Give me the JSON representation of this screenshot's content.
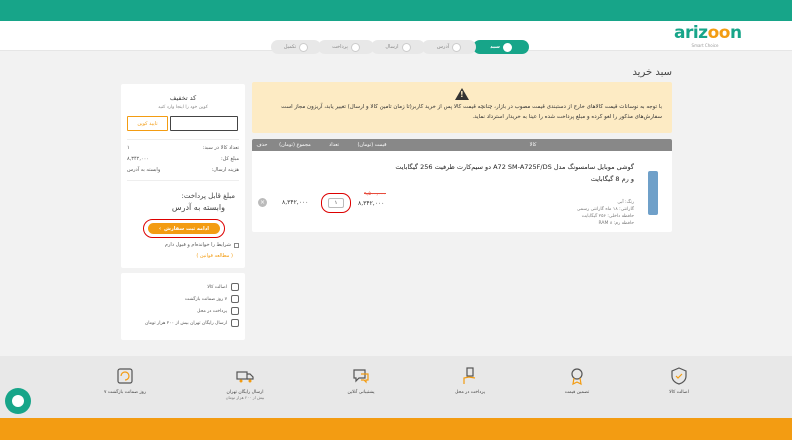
{
  "logo": {
    "brand_a": "ariz",
    "brand_o": "oo",
    "brand_b": "n",
    "tagline": "Smart Choice"
  },
  "steps": [
    {
      "label": "سبد",
      "icon": "basket-icon",
      "active": true
    },
    {
      "label": "آدرس",
      "icon": "location-icon",
      "active": false
    },
    {
      "label": "ارسال",
      "icon": "truck-icon",
      "active": false
    },
    {
      "label": "پرداخت",
      "icon": "card-icon",
      "active": false
    },
    {
      "label": "تکمیل",
      "icon": "check-icon",
      "active": false
    }
  ],
  "page_title": "سبد خرید",
  "warning": {
    "text": "با توجه به نوسانات قیمت کالاهای خارج از دستبندی قیمت مصوب در بازار، چنانچه قیمت کالا پس از خرید کاربر(تا زمان تامین کالا و ارسال) تغییر یابد، آریزون مجاز است سفارش‌های مذکور را لغو کرده و مبلغ پرداخت شده را عینا به خریدار استرداد نماید."
  },
  "table": {
    "headers": {
      "goods": "کالا",
      "price": "قیمت (تومان)",
      "qty": "تعداد",
      "total": "مجموع (تومان)",
      "del": "حذف"
    },
    "item": {
      "title": "گوشی موبایل سامسونگ مدل A72 SM-A725F/DS دو سیم‌کارت ظرفیت 256 گیگابایت و رم 8 گیگابایت",
      "meta_color": "رنگ: آبی",
      "meta_warranty": "گارانتی: ۱۸ ماه گارانتی رسمی",
      "meta_storage": "حافظه داخلی: ۲۵۶ گیگابایت",
      "meta_ram": "حافظه رم: ۸ RAM",
      "old_price": "۹,۵۰۰,۰۰۰",
      "price": "۸,۳۴۲,۰۰۰",
      "qty": "۱",
      "total": "۸,۳۴۲,۰۰۰",
      "del_glyph": "×"
    }
  },
  "summary": {
    "discount_title": "کد تخفیف",
    "discount_sub": "کوپن خود را اینجا وارد کنید",
    "coupon_placeholder": "",
    "coupon_button": "تایید کوپن",
    "count_label": "تعداد کالا در سبد:",
    "count_value": "۱",
    "amount_label": "مبلغ کل:",
    "amount_value": "۸,۳۴۲,۰۰۰",
    "shipping_label": "هزینه ارسال:",
    "shipping_value": "وابسته به آدرس",
    "pay_label": "مبلغ قابل پرداخت:",
    "pay_value": "وابسته به آدرس",
    "continue_label": "ادامه ثبت سفارش",
    "continue_arrow": "‹",
    "terms_text": "شرایط را خوانده‌ام و قبول دارم",
    "terms_link": "( مطالعه قوانین )"
  },
  "features": [
    {
      "label": "اصالت کالا",
      "icon": "shield-icon"
    },
    {
      "label": "۷ روز ضمانت بازگشت",
      "icon": "return-icon"
    },
    {
      "label": "پرداخت در محل",
      "icon": "hand-pay-icon"
    },
    {
      "label": "ارسال رایگان تهران بیش از ۲۰۰ هزار تومان",
      "icon": "truck-icon"
    }
  ],
  "footer": [
    {
      "label": "اصالت کالا",
      "sub": "",
      "icon": "shield-icon"
    },
    {
      "label": "تضمین قیمت",
      "sub": "",
      "icon": "medal-icon"
    },
    {
      "label": "پرداخت در محل",
      "sub": "",
      "icon": "hand-pay-icon"
    },
    {
      "label": "پشتیبانی آنلاین",
      "sub": "",
      "icon": "support-icon"
    },
    {
      "label": "ارسال رایگان تهران",
      "sub": "بیش از ۲۰۰ هزار تومان",
      "icon": "truck-icon"
    },
    {
      "label": "۷ روز ضمانت بازگشت",
      "sub": "",
      "icon": "return-icon"
    }
  ],
  "colors": {
    "brand": "#17a589",
    "accent": "#f39c12",
    "warning_bg": "#fdebc4",
    "highlight": "#dd0000"
  }
}
